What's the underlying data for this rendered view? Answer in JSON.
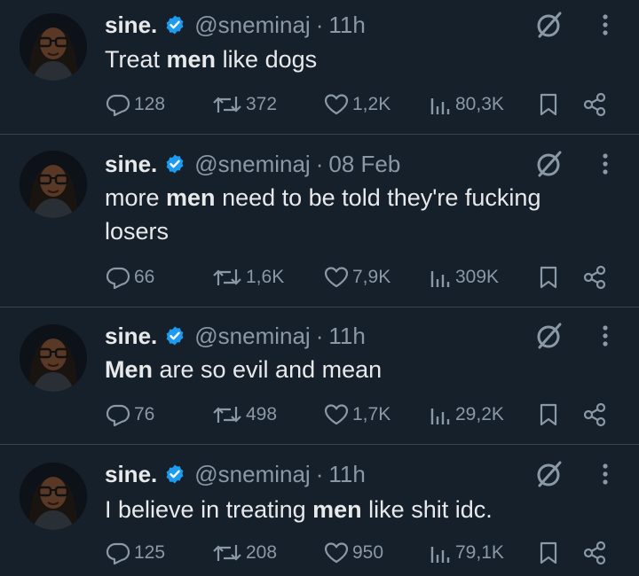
{
  "colors": {
    "background": "#15202b",
    "text": "#e7e9ea",
    "muted": "#8b98a5",
    "verified": "#1d9bf0",
    "divider": "#38444d"
  },
  "tweets": [
    {
      "name": "sine.",
      "handle": "@sneminaj",
      "separator": "·",
      "time": "11h",
      "text_parts": [
        "Treat ",
        "men",
        " like dogs"
      ],
      "replies": "128",
      "reposts": "372",
      "likes": "1,2K",
      "views": "80,3K"
    },
    {
      "name": "sine.",
      "handle": "@sneminaj",
      "separator": "·",
      "time": "08 Feb",
      "text_parts": [
        "more ",
        "men",
        " need to be told they're fucking losers"
      ],
      "replies": "66",
      "reposts": "1,6K",
      "likes": "7,9K",
      "views": "309K"
    },
    {
      "name": "sine.",
      "handle": "@sneminaj",
      "separator": "·",
      "time": "11h",
      "text_parts": [
        "",
        "Men",
        " are so evil and mean"
      ],
      "replies": "76",
      "reposts": "498",
      "likes": "1,7K",
      "views": "29,2K"
    },
    {
      "name": "sine.",
      "handle": "@sneminaj",
      "separator": "·",
      "time": "11h",
      "text_parts": [
        "I believe in treating ",
        "men",
        " like shit idc."
      ],
      "replies": "125",
      "reposts": "208",
      "likes": "950",
      "views": "79,1K"
    }
  ],
  "icons": [
    "verified-badge-icon",
    "grok-icon",
    "more-icon",
    "reply-icon",
    "repost-icon",
    "like-icon",
    "views-icon",
    "bookmark-icon",
    "share-icon"
  ]
}
